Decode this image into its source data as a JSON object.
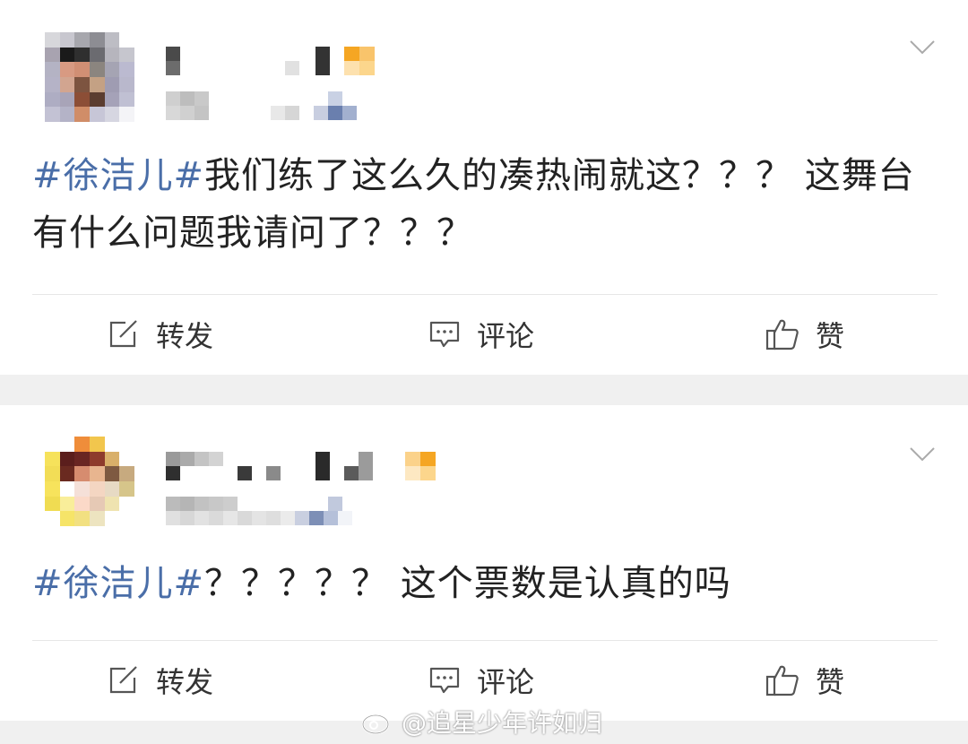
{
  "posts": [
    {
      "topic": "#徐洁儿#",
      "body": "我们练了这么久的凑热闹就这？？？ 这舞台有什么问题我请问了？？？",
      "actions": {
        "forward": "转发",
        "comment": "评论",
        "like": "赞"
      }
    },
    {
      "topic": "#徐洁儿#",
      "body": "？？？？？ 这个票数是认真的吗",
      "actions": {
        "forward": "转发",
        "comment": "评论",
        "like": "赞"
      }
    }
  ],
  "watermark": {
    "text": "@追星少年许如归"
  },
  "icons": {
    "menu": "chevron-down-icon",
    "forward": "share-edit-icon",
    "comment": "comment-bubble-icon",
    "like": "thumbs-up-icon",
    "watermark": "weibo-logo-icon"
  },
  "colors": {
    "topic": "#4a6ea8",
    "text": "#222222",
    "action_text": "#333333",
    "divider": "#e6e6e6",
    "page_bg": "#f0f0f0"
  }
}
